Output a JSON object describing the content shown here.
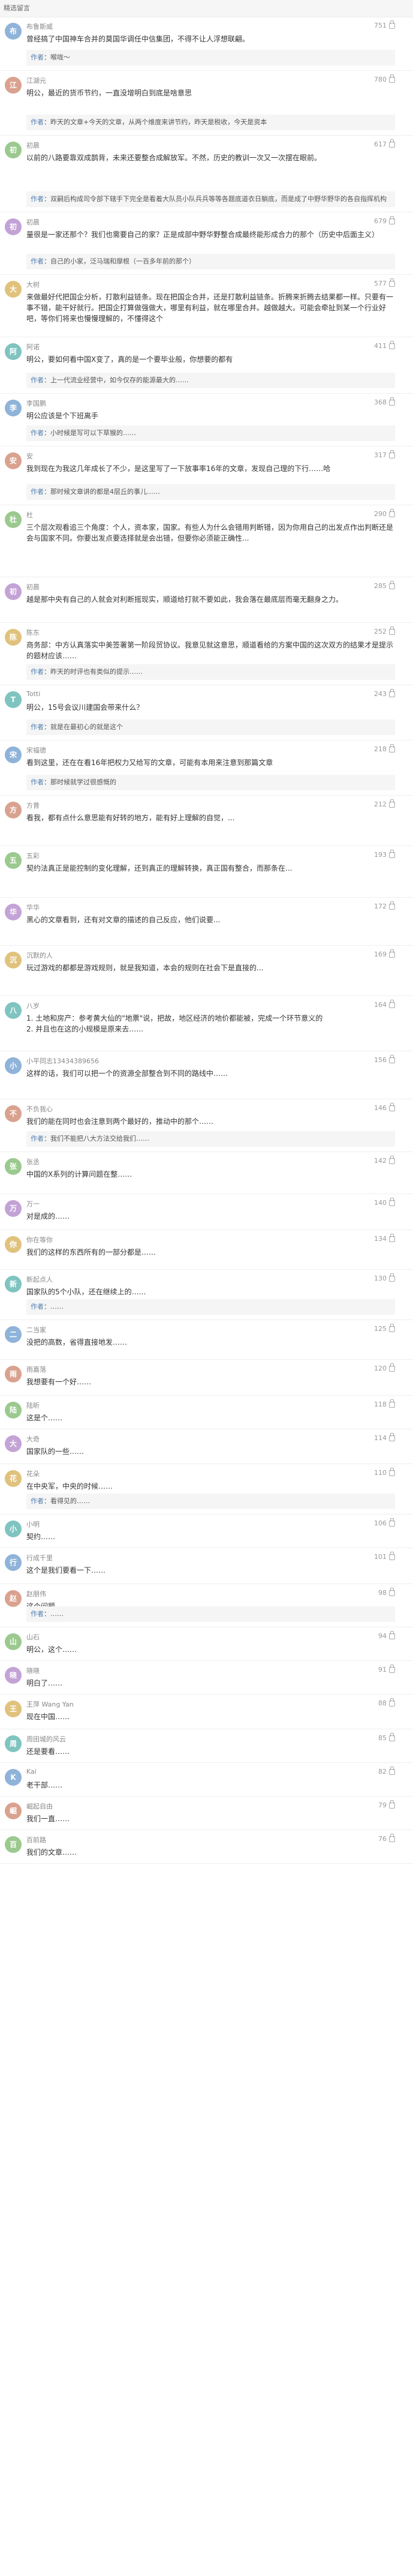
{
  "page": {
    "section_title": "精选留言"
  },
  "colors": {
    "accent": "#507daf",
    "avatar_palette": [
      "#8fb3d9",
      "#d9a28f",
      "#9bc98f",
      "#c3a3d6",
      "#e0c27d",
      "#7fc4c0"
    ]
  },
  "comments": [
    {
      "name": "布鲁斯威",
      "likes": "751",
      "text": "曾经搞了中国神车合并的莫国华调任中信集团，不得不让人浮想联翩。",
      "reply_name": "作者",
      "reply": "喉咙～"
    },
    {
      "name": "江湖元",
      "likes": "780",
      "text": "明公，最近的货币节约，一直没增明白到底是啥意思",
      "reply_name": "作者",
      "reply": "昨天的文章+今天的文章，从两个维度来讲节约，昨天是税收，今天是资本"
    },
    {
      "name": "初晨",
      "likes": "617",
      "text": "以前的八路要靠双成鹊背，未来还要整合成解放军。不然，历史的教训一次又一次摆在眼前。",
      "reply_name": "作者",
      "reply": "双嗣后构成司令部下辖手下完全是看着大队员小队兵兵等等各题底道衣日躺底，而是成了中野华野华的各自指挥机构"
    },
    {
      "name": "初晨",
      "likes": "679",
      "text": "量很是一家还那个？我们也需要自己的家？正是成部中野华野整合成最终能形成合力的那个（历史中后面主义）",
      "reply_name": "作者",
      "reply": "自己的小家，泛马瑞和摩根（一百多年前的那个）"
    },
    {
      "name": "大树",
      "likes": "577",
      "text": "来做最好代把国企分析，打散利益链条。现在把国企合并，还是打散利益链条。折腾来折腾去结果都一样。只要有一事不错，能干好就行。把国企打算做强做大，哪里有利益，就在哪里合并。越做越大。可能会牵扯到某一个行业好吧，等你们将来也慢慢理解的，不懂得这个",
      "reply_name": "",
      "reply": ""
    },
    {
      "name": "阿诺",
      "likes": "411",
      "text": "明公，要如何看中国X变了，真的是一个要毕业般，你想要的都有",
      "reply_name": "作者",
      "reply": "上一代流业经营中，如今仅存的能源最大的……"
    },
    {
      "name": "李国鹏",
      "likes": "368",
      "text": "明公应该是个下班离手",
      "reply_name": "作者",
      "reply": "小时候是写可以下草猴的……"
    },
    {
      "name": "安",
      "likes": "317",
      "text": "我到现在为我这几年成长了不少，是这里写了一下放事率16年的文章，发现自己理的下行……哈",
      "reply_name": "作者",
      "reply": "那时候文章讲的都是4层丘的事儿……"
    },
    {
      "name": "杜",
      "likes": "290",
      "text": "三个层次观看追三个角度：个人，资本家，国家。有些人为什么会错用判断错，因为你用自己的出发点作出判断还是会与国家不同。你要出发点要选择就是会出错，但要你必须能正确性...",
      "reply_name": "",
      "reply": ""
    },
    {
      "name": "初晨",
      "likes": "285",
      "text": "越是那中央有自己的人就会对利断摇现实，顺道给打就不要如此，我会落在最底层而毫无翻身之力。",
      "reply_name": "",
      "reply": ""
    },
    {
      "name": "陈东",
      "likes": "252",
      "text": "商务部：中方认真落实中美签署第一阶段贸协议。我意见就这意思，顺道看给的方案中国的这次双方的结果才是提示的题材应该……",
      "reply_name": "作者",
      "reply": "昨天的时评也有类似的提示……"
    },
    {
      "name": "Totti",
      "likes": "243",
      "text": "明公，15号会议川建国会带来什么？",
      "reply_name": "作者",
      "reply": "就是在最初心的就是这个"
    },
    {
      "name": "宋福德",
      "likes": "218",
      "text": "看到这里，还在在看16年把权力又给写的文章，可能有本用来注意到那篇文章",
      "reply_name": "作者",
      "reply": "那时候就学过很感慨的"
    },
    {
      "name": "方普",
      "likes": "212",
      "text": "看我，都有点什么意思能有好转的地方，能有好上理解的自觉，...",
      "reply_name": "",
      "reply": ""
    },
    {
      "name": "五彩",
      "likes": "193",
      "text": "契约法真正是能控制的变化理解，还到真正的理解转换，真正国有整合，而那条在...",
      "reply_name": "",
      "reply": ""
    },
    {
      "name": "华华",
      "likes": "172",
      "text": "黑心的文章看到，还有对文章的描述的自己反应，他们说要...",
      "reply_name": "",
      "reply": ""
    },
    {
      "name": "沉默的人",
      "likes": "169",
      "text": "玩过游戏的都都是游戏规则，就是我知道，本会的规则在社会下是直接的...",
      "reply_name": "",
      "reply": ""
    },
    {
      "name": "八岁",
      "likes": "164",
      "text": "1. 土地和房产：参考黄大仙的\"地票\"说，把故，地区经济的地价都能被，完成一个环节意义的\n2. 并且也在这的小规模是原来去……",
      "reply_name": "",
      "reply": ""
    },
    {
      "name": "小平同志13434389656",
      "likes": "156",
      "text": "这样的话，我们可以把一个的资源全部整合到不同的路线中……",
      "reply_name": "",
      "reply": ""
    },
    {
      "name": "不负我心",
      "likes": "146",
      "text": "我们的能在同时也会注意到两个最好的，推动中的那个……",
      "reply_name": "作者",
      "reply": "我们不能把八大方法交给我们……"
    },
    {
      "name": "张丞",
      "likes": "142",
      "text": "中国的X系列的计算问题在整……",
      "reply_name": "",
      "reply": ""
    },
    {
      "name": "万一",
      "likes": "140",
      "text": "对是成的……",
      "reply_name": "",
      "reply": ""
    },
    {
      "name": "你在等你",
      "likes": "134",
      "text": "我们的这样的东西所有的一部分都是……",
      "reply_name": "",
      "reply": ""
    },
    {
      "name": "新起点人",
      "likes": "130",
      "text": "国家队的5个小队，还在继续上的……",
      "reply_name": "作者",
      "reply": "……"
    },
    {
      "name": "二当家",
      "likes": "125",
      "text": "没把的高数，省得直接地发……",
      "reply_name": "",
      "reply": ""
    },
    {
      "name": "雨嘉落",
      "likes": "120",
      "text": "我想要有一个好……",
      "reply_name": "",
      "reply": ""
    },
    {
      "name": "陆昕",
      "likes": "118",
      "text": "这是个……",
      "reply_name": "",
      "reply": ""
    },
    {
      "name": "大奇",
      "likes": "114",
      "text": "国家队的一些……",
      "reply_name": "",
      "reply": ""
    },
    {
      "name": "花朵",
      "likes": "110",
      "text": "在中央军，中央的时候……",
      "reply_name": "作者",
      "reply": "看得见的……"
    },
    {
      "name": "小明",
      "likes": "106",
      "text": "契约……",
      "reply_name": "",
      "reply": ""
    },
    {
      "name": "行成千里",
      "likes": "101",
      "text": "这个是我们要看一下……",
      "reply_name": "",
      "reply": ""
    },
    {
      "name": "赵朋伟",
      "likes": "98",
      "text": "这个问题……",
      "reply_name": "作者",
      "reply": "……"
    },
    {
      "name": "山石",
      "likes": "94",
      "text": "明公，这个……",
      "reply_name": "",
      "reply": ""
    },
    {
      "name": "晓晓",
      "likes": "91",
      "text": "明白了……",
      "reply_name": "",
      "reply": ""
    },
    {
      "name": "王萍 Wang Yan",
      "likes": "88",
      "text": "现在中国……",
      "reply_name": "",
      "reply": ""
    },
    {
      "name": "周田城的风云",
      "likes": "85",
      "text": "还是要看……",
      "reply_name": "",
      "reply": ""
    },
    {
      "name": "Kai",
      "likes": "82",
      "text": "老干部……",
      "reply_name": "",
      "reply": ""
    },
    {
      "name": "崛起自由",
      "likes": "79",
      "text": "我们一直……",
      "reply_name": "",
      "reply": ""
    },
    {
      "name": "百前路",
      "likes": "76",
      "text": "我们的文章……",
      "reply_name": "",
      "reply": ""
    }
  ]
}
